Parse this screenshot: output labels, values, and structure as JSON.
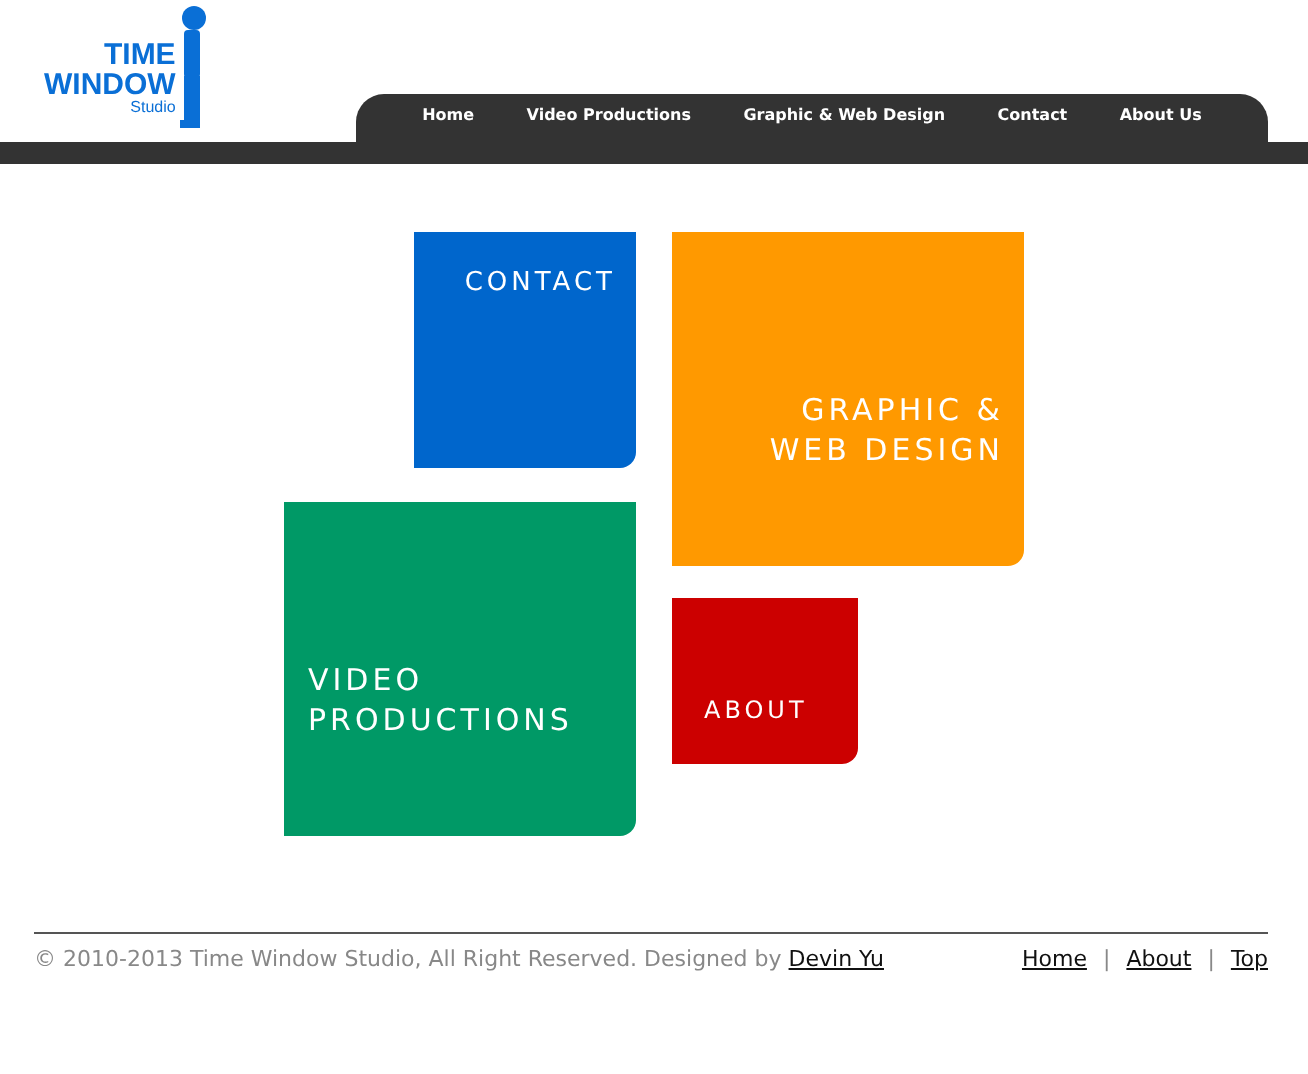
{
  "logo": {
    "line_1": "TIME",
    "line_2": "WINDOW",
    "line_3": "Studio"
  },
  "nav": [
    {
      "label": "Home"
    },
    {
      "label": "Video Productions"
    },
    {
      "label": "Graphic & Web Design"
    },
    {
      "label": "Contact"
    },
    {
      "label": "About Us"
    }
  ],
  "tiles": [
    {
      "label": "CONTACT",
      "color": "#0066cc",
      "kind": "contact"
    },
    {
      "label": "VIDEO PRODUCTIONS",
      "color": "#009966",
      "kind": "video"
    },
    {
      "label": "GRAPHIC & WEB DESIGN",
      "color": "#ff9900",
      "kind": "graphic"
    },
    {
      "label": "ABOUT",
      "color": "#cc0000",
      "kind": "about"
    }
  ],
  "footer": {
    "copyright": "© 2010-2013 Time Window Studio, All Right Reserved. Designed by",
    "designer": "Devin Yu",
    "links": [
      {
        "kind": "link",
        "text": "Home"
      },
      {
        "kind": "separator",
        "text": "|"
      },
      {
        "kind": "link",
        "text": "About"
      },
      {
        "kind": "separator",
        "text": "|"
      },
      {
        "kind": "link",
        "text": "Top"
      }
    ]
  }
}
